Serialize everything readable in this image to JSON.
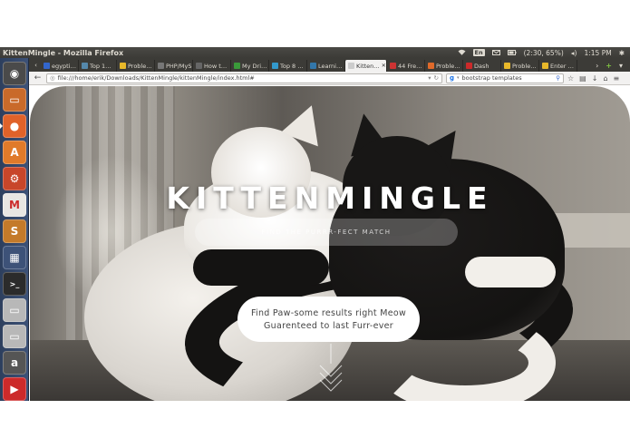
{
  "window": {
    "title": "KittenMingle - Mozilla Firefox",
    "indicators": {
      "keyboard": "En",
      "battery": "(2:30, 65%)",
      "time": "1:15 PM"
    }
  },
  "launcher": {
    "items": [
      {
        "icon": "ubuntu-dash-icon",
        "color": "#4a4a4a"
      },
      {
        "icon": "files-icon",
        "color": "#c96a2a"
      },
      {
        "icon": "firefox-icon",
        "color": "#e0622a"
      },
      {
        "icon": "software-center-icon",
        "color": "#e07a2a"
      },
      {
        "icon": "settings-icon",
        "color": "#c8462a"
      },
      {
        "icon": "gmail-icon",
        "color": "#e8e6e3"
      },
      {
        "icon": "sublime-icon",
        "color": "#c47a2a"
      },
      {
        "icon": "workspace-icon",
        "color": "#3d5278"
      },
      {
        "icon": "terminal-icon",
        "color": "#2b2b2b"
      },
      {
        "icon": "drive-icon",
        "color": "#b8b8b8"
      },
      {
        "icon": "drive-icon",
        "color": "#b8b8b8"
      },
      {
        "icon": "amazon-icon",
        "color": "#555555"
      },
      {
        "icon": "youtube-icon",
        "color": "#cc2a2a"
      }
    ]
  },
  "tabs": [
    {
      "label": "egypti…",
      "icon_color": "#3366cc"
    },
    {
      "label": "Top 1…",
      "icon_color": "#5588aa"
    },
    {
      "label": "Proble…",
      "icon_color": "#e8b82a"
    },
    {
      "label": "PHP/MyS…",
      "icon_color": "#777777"
    },
    {
      "label": "How t…",
      "icon_color": "#666666"
    },
    {
      "label": "My Dri…",
      "icon_color": "#3a9a3a"
    },
    {
      "label": "Top 8 …",
      "icon_color": "#3399cc"
    },
    {
      "label": "Learni…",
      "icon_color": "#3377aa"
    },
    {
      "label": "Kitten…",
      "icon_color": "#cccccc",
      "active": true
    },
    {
      "label": "44 Fre…",
      "icon_color": "#cc3333"
    },
    {
      "label": "Proble…",
      "icon_color": "#e06a2a"
    },
    {
      "label": "Dash",
      "icon_color": "#cc2a2a"
    },
    {
      "label": "Proble…",
      "icon_color": "#e8b82a"
    },
    {
      "label": "Enter …",
      "icon_color": "#e8b82a"
    }
  ],
  "nav": {
    "url": "file:///home/erik/Downloads/KittenMingle/kittenMingle/index.html#",
    "search": "bootstrap templates"
  },
  "page": {
    "title": "KITTENMINGLE",
    "tagline": "FIND THE PURRR-FECT MATCH",
    "cta_line1": "Find Paw-some results right Meow",
    "cta_line2": "Guarenteed to last Furr-ever"
  }
}
